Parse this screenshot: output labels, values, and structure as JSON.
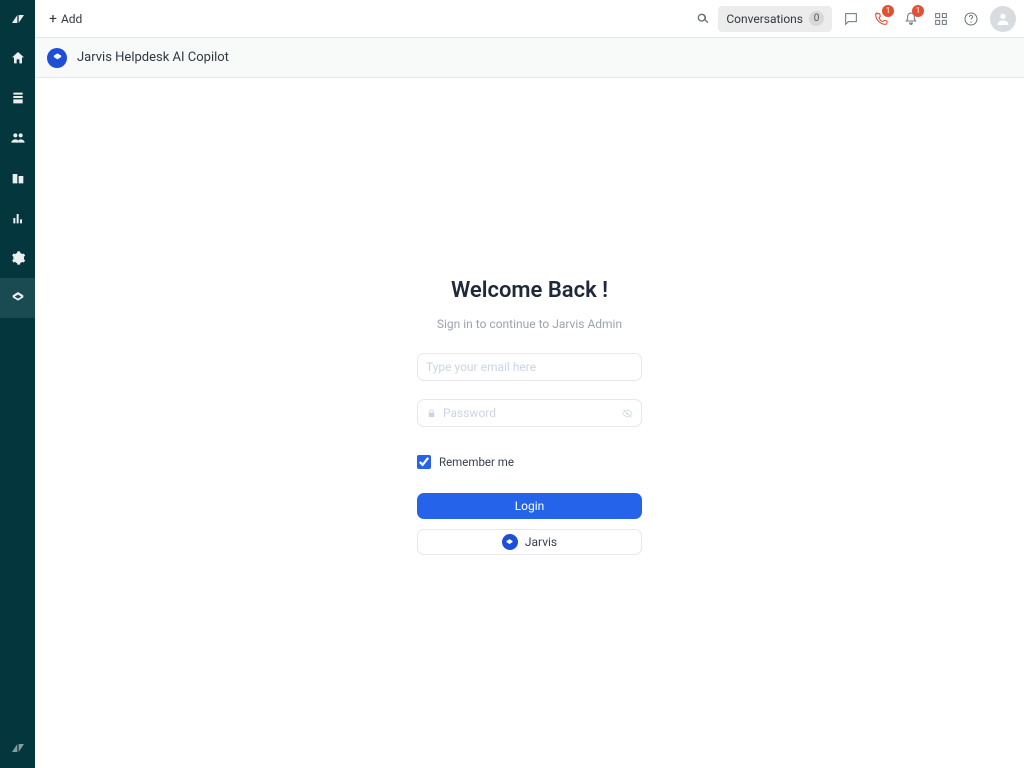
{
  "topbar": {
    "add_label": "Add",
    "conversations_label": "Conversations",
    "conversations_count": "0",
    "phone_badge": "1",
    "bell_badge": "1"
  },
  "appstrip": {
    "title": "Jarvis Helpdesk AI Copilot"
  },
  "login": {
    "heading": "Welcome Back !",
    "subheading": "Sign in to continue to Jarvis Admin",
    "email_placeholder": "Type your email here",
    "password_placeholder": "Password",
    "remember_label": "Remember me",
    "login_label": "Login",
    "jarvis_label": "Jarvis"
  },
  "icons": {
    "rail": [
      "logo",
      "home",
      "views",
      "customers",
      "organizations",
      "reporting",
      "admin",
      "jarvis"
    ],
    "footer": "zendesk"
  }
}
